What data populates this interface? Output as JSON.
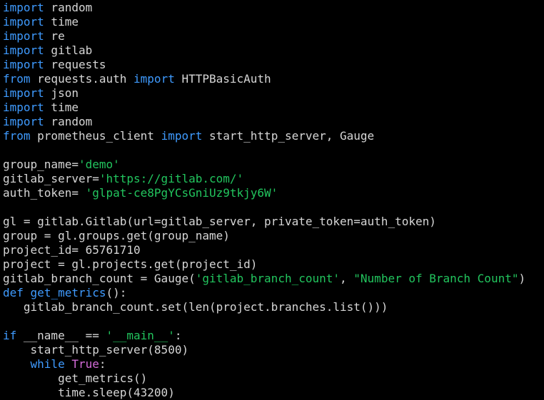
{
  "colors": {
    "background": "#000000",
    "keyword": "#3f9bff",
    "string": "#22c55e",
    "constant": "#d36bd8",
    "text": "#d6d6d6"
  },
  "lines": [
    [
      {
        "t": "kw",
        "v": "import"
      },
      {
        "t": "pl",
        "v": " random"
      }
    ],
    [
      {
        "t": "kw",
        "v": "import"
      },
      {
        "t": "pl",
        "v": " time"
      }
    ],
    [
      {
        "t": "kw",
        "v": "import"
      },
      {
        "t": "pl",
        "v": " re"
      }
    ],
    [
      {
        "t": "kw",
        "v": "import"
      },
      {
        "t": "pl",
        "v": " gitlab"
      }
    ],
    [
      {
        "t": "kw",
        "v": "import"
      },
      {
        "t": "pl",
        "v": " requests"
      }
    ],
    [
      {
        "t": "kw",
        "v": "from"
      },
      {
        "t": "pl",
        "v": " requests.auth "
      },
      {
        "t": "kw",
        "v": "import"
      },
      {
        "t": "pl",
        "v": " HTTPBasicAuth"
      }
    ],
    [
      {
        "t": "kw",
        "v": "import"
      },
      {
        "t": "pl",
        "v": " json"
      }
    ],
    [
      {
        "t": "kw",
        "v": "import"
      },
      {
        "t": "pl",
        "v": " time"
      }
    ],
    [
      {
        "t": "kw",
        "v": "import"
      },
      {
        "t": "pl",
        "v": " random"
      }
    ],
    [
      {
        "t": "kw",
        "v": "from"
      },
      {
        "t": "pl",
        "v": " prometheus_client "
      },
      {
        "t": "kw",
        "v": "import"
      },
      {
        "t": "pl",
        "v": " start_http_server, Gauge"
      }
    ],
    [],
    [
      {
        "t": "pl",
        "v": "group_name="
      },
      {
        "t": "str",
        "v": "'demo'"
      }
    ],
    [
      {
        "t": "pl",
        "v": "gitlab_server="
      },
      {
        "t": "str",
        "v": "'https://gitlab.com/'"
      }
    ],
    [
      {
        "t": "pl",
        "v": "auth_token= "
      },
      {
        "t": "str",
        "v": "'glpat-ce8PgYCsGniUz9tkjy6W'"
      }
    ],
    [],
    [
      {
        "t": "pl",
        "v": "gl = gitlab.Gitlab(url=gitlab_server, private_token=auth_token)"
      }
    ],
    [
      {
        "t": "pl",
        "v": "group = gl.groups.get(group_name)"
      }
    ],
    [
      {
        "t": "pl",
        "v": "project_id= 65761710"
      }
    ],
    [
      {
        "t": "pl",
        "v": "project = gl.projects.get(project_id)"
      }
    ],
    [
      {
        "t": "pl",
        "v": "gitlab_branch_count = Gauge("
      },
      {
        "t": "str",
        "v": "'gitlab_branch_count'"
      },
      {
        "t": "pl",
        "v": ", "
      },
      {
        "t": "str",
        "v": "\"Number of Branch Count\""
      },
      {
        "t": "pl",
        "v": ")"
      }
    ],
    [
      {
        "t": "kw",
        "v": "def"
      },
      {
        "t": "pl",
        "v": " "
      },
      {
        "t": "kw",
        "v": "get_metrics"
      },
      {
        "t": "pl",
        "v": "():"
      }
    ],
    [
      {
        "t": "pl",
        "v": "   gitlab_branch_count.set(len(project.branches.list()))"
      }
    ],
    [],
    [
      {
        "t": "kw",
        "v": "if"
      },
      {
        "t": "pl",
        "v": " __name__ == "
      },
      {
        "t": "str",
        "v": "'__main__'"
      },
      {
        "t": "pl",
        "v": ":"
      }
    ],
    [
      {
        "t": "pl",
        "v": "    start_http_server(8500)"
      }
    ],
    [
      {
        "t": "pl",
        "v": "    "
      },
      {
        "t": "kw",
        "v": "while"
      },
      {
        "t": "pl",
        "v": " "
      },
      {
        "t": "tr",
        "v": "True"
      },
      {
        "t": "pl",
        "v": ":"
      }
    ],
    [
      {
        "t": "pl",
        "v": "        get_metrics()"
      }
    ],
    [
      {
        "t": "pl",
        "v": "        time.sleep(43200)"
      }
    ]
  ]
}
